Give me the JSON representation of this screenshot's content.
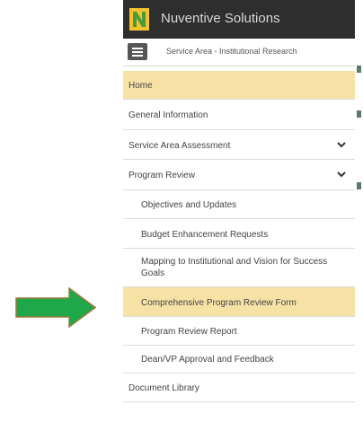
{
  "app": {
    "title": "Nuventive Solutions",
    "logo_colors": {
      "primary": "#f2c230",
      "secondary": "#4a9a3a"
    }
  },
  "breadcrumb": {
    "text": "Service Area - Institutional Research"
  },
  "nav": {
    "items": [
      {
        "label": "Home",
        "active": true
      },
      {
        "label": "General Information"
      },
      {
        "label": "Service Area Assessment",
        "expandable": true
      },
      {
        "label": "Program Review",
        "expandable": true,
        "expanded": true
      },
      {
        "label": "Objectives and Updates",
        "sub": true
      },
      {
        "label": "Budget Enhancement Requests",
        "sub": true
      },
      {
        "label": "Mapping to Institutional and Vision for Success Goals",
        "sub": true
      },
      {
        "label": "Comprehensive Program Review Form",
        "sub": true,
        "active": true
      },
      {
        "label": "Program Review Report",
        "sub": true
      },
      {
        "label": "Dean/VP Approval and Feedback",
        "sub": true
      },
      {
        "label": "Document Library"
      }
    ]
  },
  "colors": {
    "topbar": "#2e2e2e",
    "active_item": "#f7e2a6",
    "annotation_arrow": "#1fa84a"
  },
  "annotation": {
    "icon": "right-arrow-icon",
    "points_to": "Comprehensive Program Review Form"
  }
}
